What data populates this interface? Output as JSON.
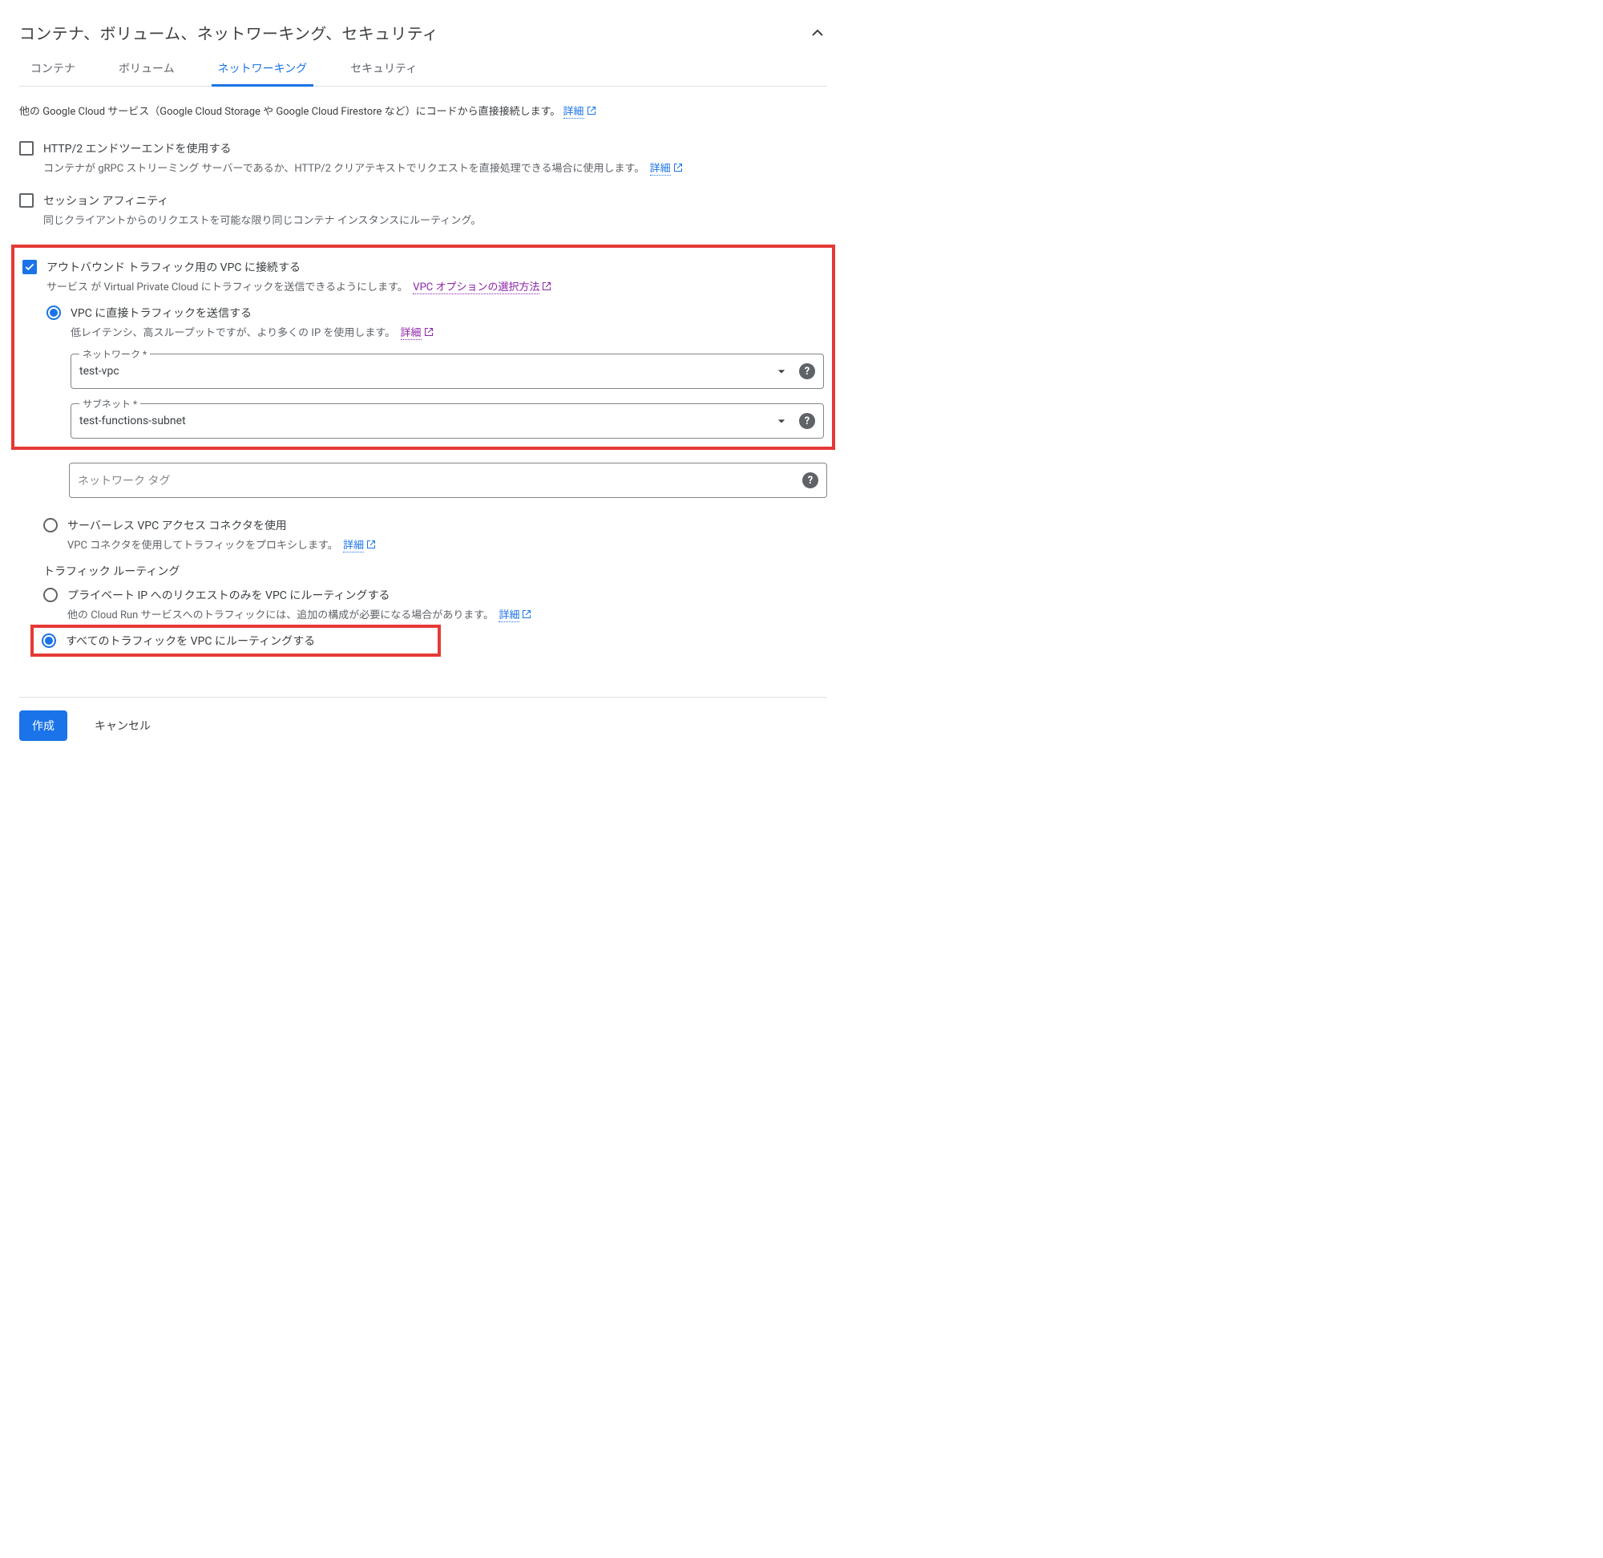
{
  "section": {
    "title": "コンテナ、ボリューム、ネットワーキング、セキュリティ"
  },
  "tabs": {
    "container": "コンテナ",
    "volume": "ボリューム",
    "networking": "ネットワーキング",
    "security": "セキュリティ"
  },
  "intro": {
    "text": "他の Google Cloud サービス（Google Cloud Storage や Google Cloud Firestore など）にコードから直接接続します。",
    "link": "詳細"
  },
  "http2": {
    "label": "HTTP/2 エンドツーエンドを使用する",
    "desc": "コンテナが gRPC ストリーミング サーバーであるか、HTTP/2 クリアテキストでリクエストを直接処理できる場合に使用します。",
    "link": "詳細"
  },
  "session": {
    "label": "セッション アフィニティ",
    "desc": "同じクライアントからのリクエストを可能な限り同じコンテナ インスタンスにルーティング。"
  },
  "vpc": {
    "label": "アウトバウンド トラフィック用の VPC に接続する",
    "desc": "サービス が Virtual Private Cloud にトラフィックを送信できるようにします。",
    "link": "VPC オプションの選択方法",
    "direct": {
      "label": "VPC に直接トラフィックを送信する",
      "desc": "低レイテンシ、高スループットですが、より多くの IP を使用します。",
      "link": "詳細"
    },
    "network_field": {
      "label": "ネットワーク *",
      "value": "test-vpc"
    },
    "subnet_field": {
      "label": "サブネット *",
      "value": "test-functions-subnet"
    },
    "tags_field": {
      "placeholder": "ネットワーク タグ"
    },
    "connector": {
      "label": "サーバーレス VPC アクセス コネクタを使用",
      "desc": "VPC コネクタを使用してトラフィックをプロキシします。",
      "link": "詳細"
    }
  },
  "routing": {
    "heading": "トラフィック ルーティング",
    "private": {
      "label": "プライベート IP へのリクエストのみを VPC にルーティングする",
      "desc": "他の Cloud Run サービスへのトラフィックには、追加の構成が必要になる場合があります。",
      "link": "詳細"
    },
    "all": {
      "label": "すべてのトラフィックを VPC にルーティングする"
    }
  },
  "footer": {
    "create": "作成",
    "cancel": "キャンセル"
  }
}
